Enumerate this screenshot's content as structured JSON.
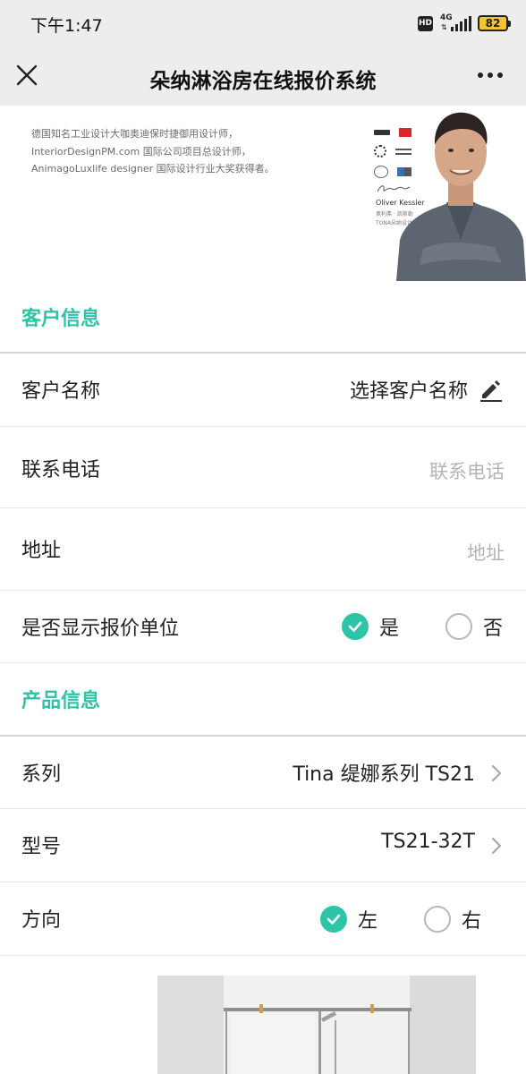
{
  "status_bar": {
    "time": "下午1:47",
    "hd": "HD",
    "network": "4G",
    "battery": "82"
  },
  "header": {
    "title": "朵纳淋浴房在线报价系统"
  },
  "banner": {
    "lines": [
      "德国知名工业设计大咖奥迪保时捷御用设计师，",
      "InteriorDesignPM.com 国际公司项目总设计师，",
      "AnimagoLuxlife designer 国际设计行业大奖获得者。"
    ],
    "designer_name": "Oliver Kessler",
    "designer_sub": "奥利弗 · 凯斯勒",
    "designer_sub2": "TONA朵纳设计总监"
  },
  "customer_section": {
    "title": "客户信息",
    "name_label": "客户名称",
    "name_value": "选择客户名称",
    "phone_label": "联系电话",
    "phone_placeholder": "联系电话",
    "address_label": "地址",
    "address_placeholder": "地址",
    "show_unit_label": "是否显示报价单位",
    "show_unit_yes": "是",
    "show_unit_no": "否",
    "show_unit_selected": "是"
  },
  "product_section": {
    "title": "产品信息",
    "series_label": "系列",
    "series_value": "Tina 缇娜系列 TS21",
    "model_label": "型号",
    "model_value": "TS21-32T",
    "direction_label": "方向",
    "direction_left": "左",
    "direction_right": "右",
    "direction_selected": "左"
  },
  "colors": {
    "accent": "#2ec4a8",
    "placeholder": "#b4b4b4",
    "bar_bg": "#ededed"
  },
  "icons": {
    "close": "close-icon",
    "more": "more-icon",
    "pencil": "pencil-icon",
    "chevron": "chevron-right-icon",
    "check": "check-icon"
  }
}
